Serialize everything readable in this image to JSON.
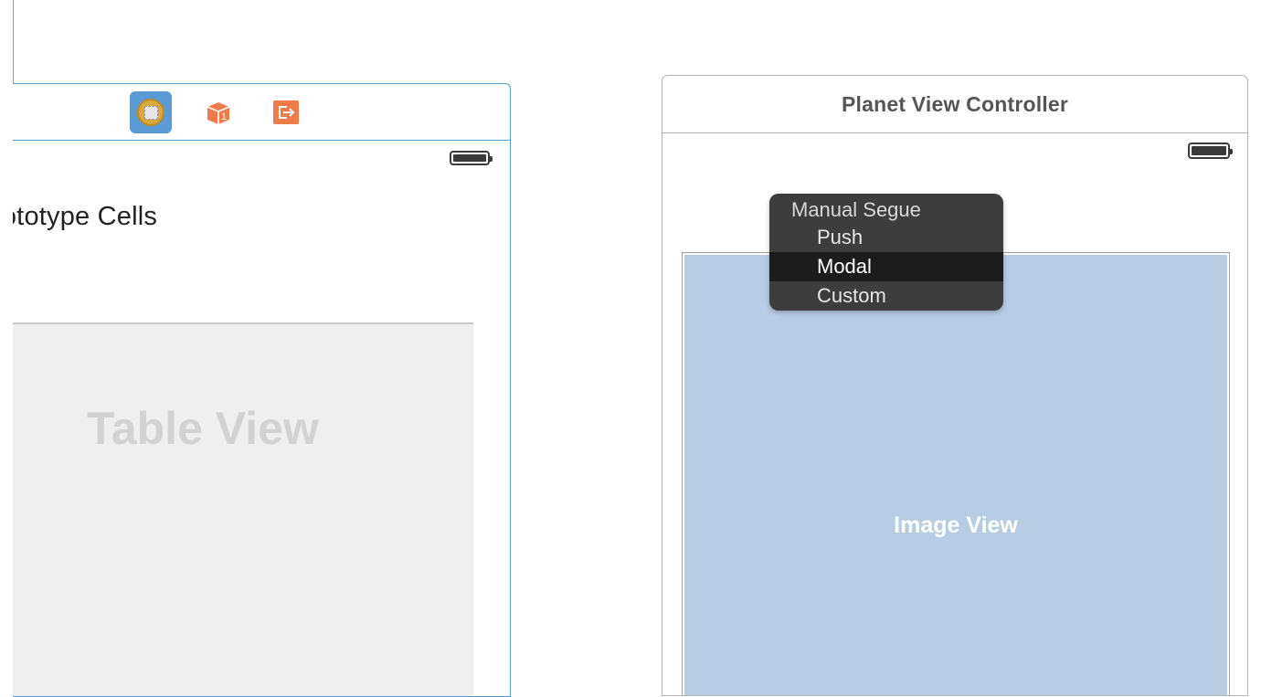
{
  "left_scene": {
    "dock_icons": {
      "view_controller": "view-controller-icon",
      "first_responder": "first-responder-icon",
      "exit": "exit-icon"
    },
    "section_title": "rototype Cells",
    "table_label": "Table View"
  },
  "right_scene": {
    "title": "Planet View Controller",
    "image_view_label": "Image View"
  },
  "segue_menu": {
    "header": "Manual Segue",
    "items": [
      {
        "label": "Push",
        "selected": false
      },
      {
        "label": "Modal",
        "selected": true
      },
      {
        "label": "Custom",
        "selected": false
      }
    ]
  },
  "colors": {
    "selection_blue": "#5b9bd5",
    "image_view_fill": "#b8cce4",
    "menu_bg": "#3d3d3d",
    "menu_highlight": "#1c1c1c",
    "dock_accent_orange": "#f07b4a"
  }
}
